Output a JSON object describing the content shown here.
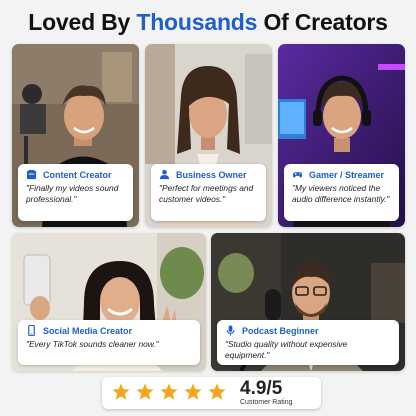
{
  "headline": {
    "prefix": "Loved By",
    "accent": "Thousands",
    "suffix": "Of Creators"
  },
  "colors": {
    "accent": "#1f5fc8",
    "star": "#f0a81e"
  },
  "testimonials": [
    {
      "role": "Content Creator",
      "icon": "video-camera-icon",
      "quote": "\"Finally my videos sound professional.\""
    },
    {
      "role": "Business Owner",
      "icon": "person-icon",
      "quote": "\"Perfect for meetings and customer videos.\""
    },
    {
      "role": "Gamer / Streamer",
      "icon": "gamepad-icon",
      "quote": "\"My viewers noticed the audio difference instantly.\""
    },
    {
      "role": "Social Media Creator",
      "icon": "smartphone-icon",
      "quote": "\"Every TikTok sounds cleaner now.\""
    },
    {
      "role": "Podcast Beginner",
      "icon": "microphone-icon",
      "quote": "\"Studio quality without expensive equipment.\""
    }
  ],
  "rating": {
    "stars": 5,
    "score": "4.9/5",
    "label": "Customer Rating"
  }
}
